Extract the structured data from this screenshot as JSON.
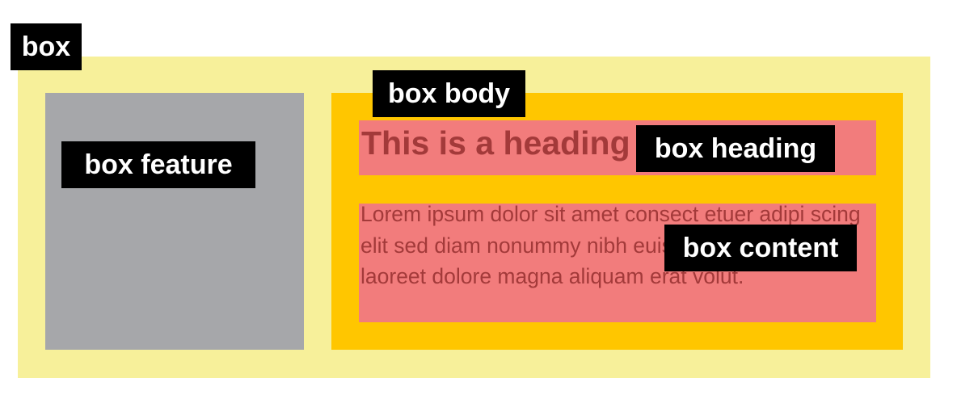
{
  "labels": {
    "box": "box",
    "box_body": "box body",
    "box_feature": "box feature",
    "box_heading": "box heading",
    "box_content": "box content"
  },
  "heading_text": "This is a heading",
  "content_text": "Lorem ipsum dolor sit amet consect etuer adipi scing elit sed diam nonummy nibh euismod tinunt ut laoreet dolore magna aliquam erat volut.",
  "colors": {
    "box": "#f7f09a",
    "feature": "#a6a7aa",
    "body": "#ffc600",
    "heading_and_content": "#f27c7c",
    "text": "#a33a3a",
    "label_bg": "#000000",
    "label_text": "#ffffff"
  }
}
